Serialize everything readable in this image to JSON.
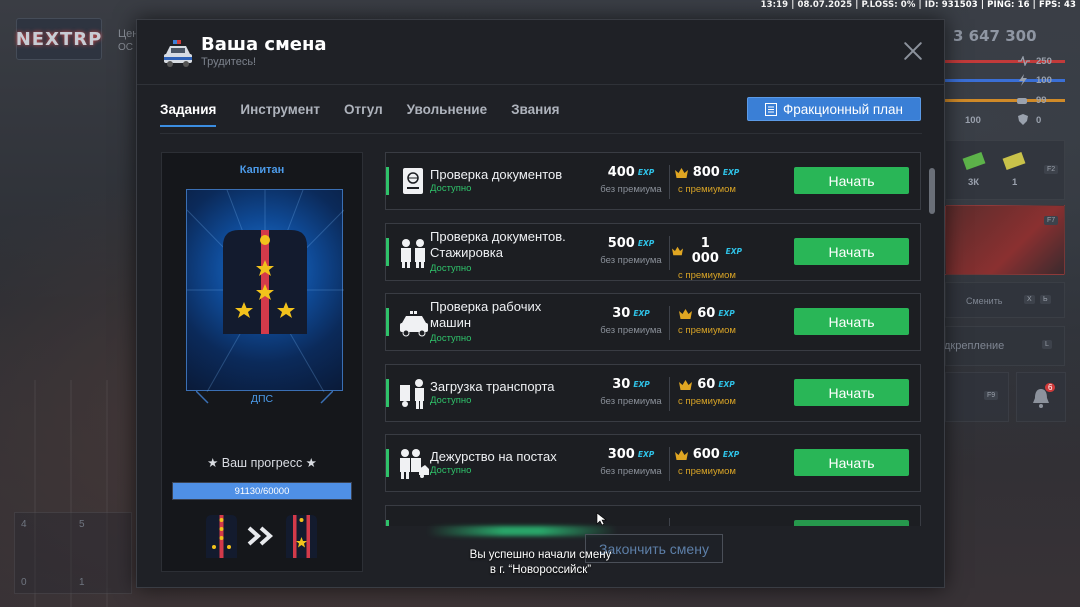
{
  "status_bar": "13:19 | 08.07.2025 | P.LOSS: 0% | ID: 931503 | PING: 16 | FPS: 43",
  "logo_text": "NEXTRP",
  "left_hud": {
    "text1": "Цен",
    "text2": "ОС"
  },
  "map_numbers": [
    "4",
    "5",
    "0",
    "1"
  ],
  "hud": {
    "money": "3 647 300",
    "stat_heart": "250",
    "stat_bolt": "100",
    "stat_strength": "99",
    "stat_small": "100",
    "stat_shield": "0",
    "item1": "3К",
    "item2": "1",
    "key_f2": "F2",
    "key_f7": "F7",
    "change_label": "Сменить",
    "key_x": "X",
    "key_b": "Ь",
    "bind_label": "дкрепление",
    "key_l": "L",
    "key_f9": "F9",
    "notif_count": "6"
  },
  "modal": {
    "title": "Ваша смена",
    "subtitle": "Трудитесь!",
    "tabs": [
      {
        "label": "Задания",
        "active": true
      },
      {
        "label": "Инструмент",
        "active": false
      },
      {
        "label": "Отгул",
        "active": false
      },
      {
        "label": "Увольнение",
        "active": false
      },
      {
        "label": "Звания",
        "active": false
      }
    ],
    "plan_button": "Фракционный план"
  },
  "rank": {
    "title": "Капитан",
    "faction": "ДПС",
    "progress_label": "★ Ваш прогресс ★",
    "progress_text": "91130/60000",
    "progress_fraction": 1.0
  },
  "exp_tag": "EXP",
  "caption_no_premium": "без премиума",
  "caption_premium": "с премиумом",
  "start_label": "Начать",
  "tasks": [
    {
      "name_line1": "Проверка документов",
      "name_line2": "",
      "status": "Доступно",
      "base": "400",
      "premium": "800",
      "icon": "passport-icon"
    },
    {
      "name_line1": "Проверка документов.",
      "name_line2": "Стажировка",
      "status": "Доступно",
      "base": "500",
      "premium": "1 000",
      "icon": "officers-icon"
    },
    {
      "name_line1": "Проверка рабочих",
      "name_line2": "машин",
      "status": "Доступно",
      "base": "30",
      "premium": "60",
      "icon": "police-car-icon"
    },
    {
      "name_line1": "Загрузка транспорта",
      "name_line2": "",
      "status": "Доступно",
      "base": "30",
      "premium": "60",
      "icon": "loading-icon"
    },
    {
      "name_line1": "Дежурство на постах",
      "name_line2": "",
      "status": "Доступно",
      "base": "300",
      "premium": "600",
      "icon": "patrol-icon"
    }
  ],
  "finish_button": "Закончить смену",
  "notice": {
    "line1": "Вы успешно начали смену",
    "line2": "в г. “Новороссийск”"
  },
  "colors": {
    "accent_blue": "#3b8de0",
    "start_green": "#29b657",
    "premium_gold": "#d7a326",
    "exp_cyan": "#2fc3e8",
    "available_green": "#2fc26a"
  }
}
